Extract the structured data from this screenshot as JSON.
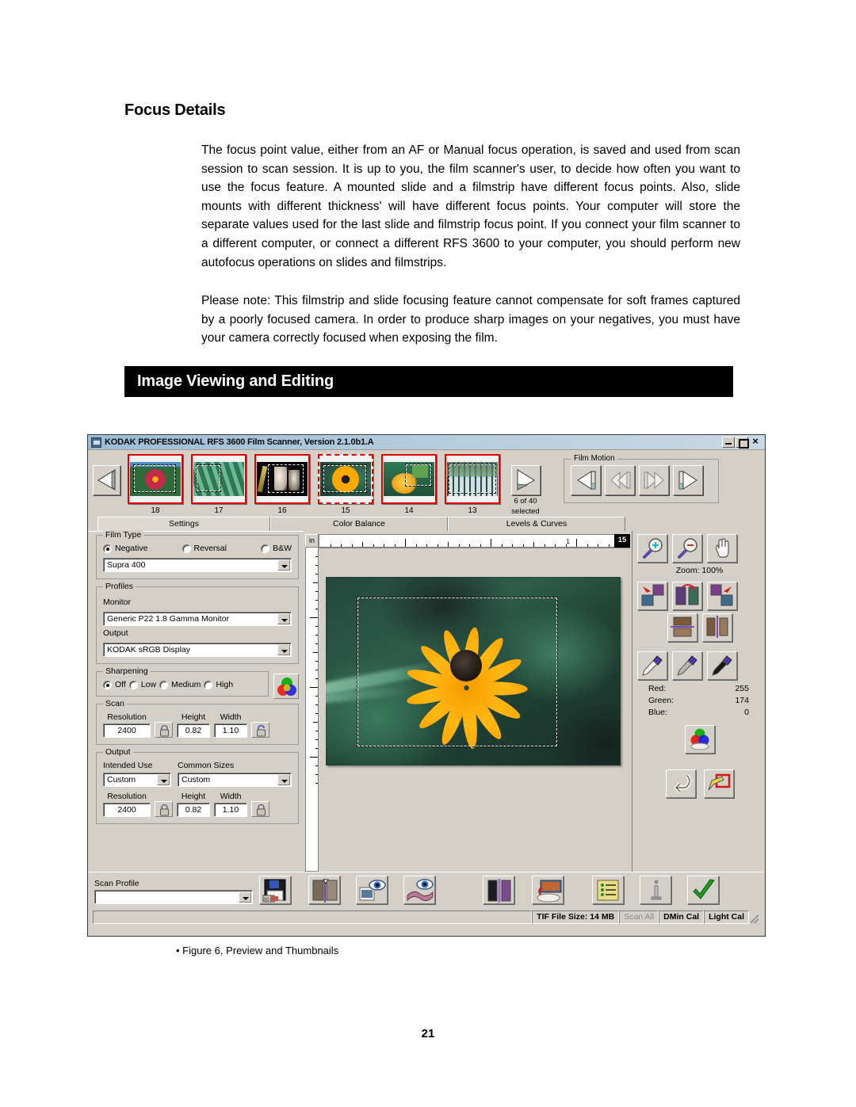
{
  "document": {
    "heading": "Focus Details",
    "paragraph1": "The focus point value, either from an AF or Manual focus operation, is saved and used from scan session to scan session.  It is up to you, the film scanner's user, to decide how often you want to use the focus feature.  A mounted slide and a filmstrip have different focus points.  Also, slide mounts with different thickness' will have different focus points.  Your computer will store the separate values used for the last slide and filmstrip focus point.  If you connect your film scanner to a different computer, or connect a different RFS 3600 to your computer, you should perform new autofocus operations on slides and filmstrips.",
    "paragraph2": "Please note:  This filmstrip and slide focusing feature cannot compensate for soft frames captured by a poorly focused camera.   In order to produce sharp images on your negatives, you must  have your camera correctly focused when exposing the film.",
    "banner": "Image Viewing and Editing",
    "figure_caption": "• Figure 6, Preview and Thumbnails",
    "page_number": "21"
  },
  "app": {
    "title": "KODAK PROFESSIONAL RFS 3600 Film Scanner, Version 2.1.0b1.A",
    "window_buttons": {
      "minimize": "minimize-button",
      "maximize": "maximize-button",
      "close": "×"
    },
    "filmstrip": {
      "prev_button_icon": "previous-frame-icon",
      "next_button_icon": "next-frame-icon",
      "thumbnails": [
        {
          "number": "18",
          "selected": true,
          "active": false
        },
        {
          "number": "17",
          "selected": true,
          "active": false
        },
        {
          "number": "16",
          "selected": true,
          "active": false
        },
        {
          "number": "15",
          "selected": true,
          "active": true
        },
        {
          "number": "14",
          "selected": true,
          "active": false
        },
        {
          "number": "13",
          "selected": true,
          "active": false
        }
      ],
      "count_line1": "6 of 40",
      "count_line2": "selected"
    },
    "film_motion": {
      "legend": "Film Motion",
      "buttons": [
        "eject-icon",
        "rewind-icon",
        "fast-forward-icon",
        "load-icon"
      ]
    },
    "tabs": [
      {
        "label": "Settings",
        "selected": true
      },
      {
        "label": "Color Balance",
        "selected": false
      },
      {
        "label": "Levels & Curves",
        "selected": false
      }
    ],
    "settings": {
      "film_type": {
        "legend": "Film Type",
        "options": [
          {
            "label": "Negative",
            "checked": true
          },
          {
            "label": "Reversal",
            "checked": false
          },
          {
            "label": "B&W",
            "checked": false
          }
        ],
        "film_stock": "Supra 400"
      },
      "profiles": {
        "legend": "Profiles",
        "monitor_label": "Monitor",
        "monitor_value": "Generic P22 1.8 Gamma Monitor",
        "output_label": "Output",
        "output_value": "KODAK sRGB Display"
      },
      "sharpening": {
        "legend": "Sharpening",
        "options": [
          {
            "label": "Off",
            "checked": true
          },
          {
            "label": "Low",
            "checked": false
          },
          {
            "label": "Medium",
            "checked": false
          },
          {
            "label": "High",
            "checked": false
          }
        ],
        "color_button_icon": "rgb-spheres-icon"
      },
      "scan": {
        "legend": "Scan",
        "resolution_label": "Resolution",
        "resolution_value": "2400",
        "height_label": "Height",
        "height_value": "0.82",
        "width_label": "Width",
        "width_value": "1.10",
        "lock_left_icon": "lock-icon",
        "lock_right_icon": "unlock-icon"
      },
      "output": {
        "legend": "Output",
        "intended_use_label": "Intended Use",
        "intended_use_value": "Custom",
        "common_sizes_label": "Common Sizes",
        "common_sizes_value": "Custom",
        "resolution_label": "Resolution",
        "resolution_value": "2400",
        "height_label": "Height",
        "height_value": "0.82",
        "width_label": "Width",
        "width_value": "1.10",
        "lock_left_icon": "lock-icon",
        "lock_right_icon": "lock-icon"
      }
    },
    "preview": {
      "ruler_unit": "in",
      "ruler_mark_1": "1",
      "frame_badge": "15"
    },
    "tools": {
      "zoom_in_icon": "zoom-in-icon",
      "zoom_out_icon": "zoom-out-icon",
      "pan_icon": "hand-pan-icon",
      "zoom_label": "Zoom:  100%",
      "rotate_left_icon": "rotate-left-icon",
      "rotate_180_icon": "rotate-180-icon",
      "rotate_right_icon": "rotate-right-icon",
      "flip_vertical_icon": "flip-vertical-icon",
      "flip_horizontal_icon": "flip-horizontal-icon",
      "eyedropper_white_icon": "eyedropper-white-icon",
      "eyedropper_gray_icon": "eyedropper-gray-icon",
      "eyedropper_black_icon": "eyedropper-black-icon",
      "rgb": {
        "red_label": "Red:",
        "red_value": "255",
        "green_label": "Green:",
        "green_value": "174",
        "blue_label": "Blue:",
        "blue_value": "0"
      },
      "color_balance_icon": "color-spheres-icon",
      "undo_icon": "undo-arrow-icon",
      "edit_icon": "edit-pencil-icon"
    },
    "bottom": {
      "scan_profile_label": "Scan Profile",
      "scan_profile_value": "",
      "save_icon": "floppy-save-icon",
      "compare_icon": "split-compare-icon",
      "preview_frame_icon": "preview-eye-icon",
      "preview_strip_icon": "filmstrip-eye-icon",
      "split_view_icon": "split-view-icon",
      "scan_to_disk_icon": "scan-to-disk-icon",
      "list_icon": "job-list-icon",
      "info_icon": "info-icon",
      "accept_icon": "green-check-icon"
    },
    "status": {
      "file_size": "TIF File Size: 14 MB",
      "scan_all": "Scan All",
      "dmin_cal": "DMin Cal",
      "light_cal": "Light Cal"
    }
  }
}
